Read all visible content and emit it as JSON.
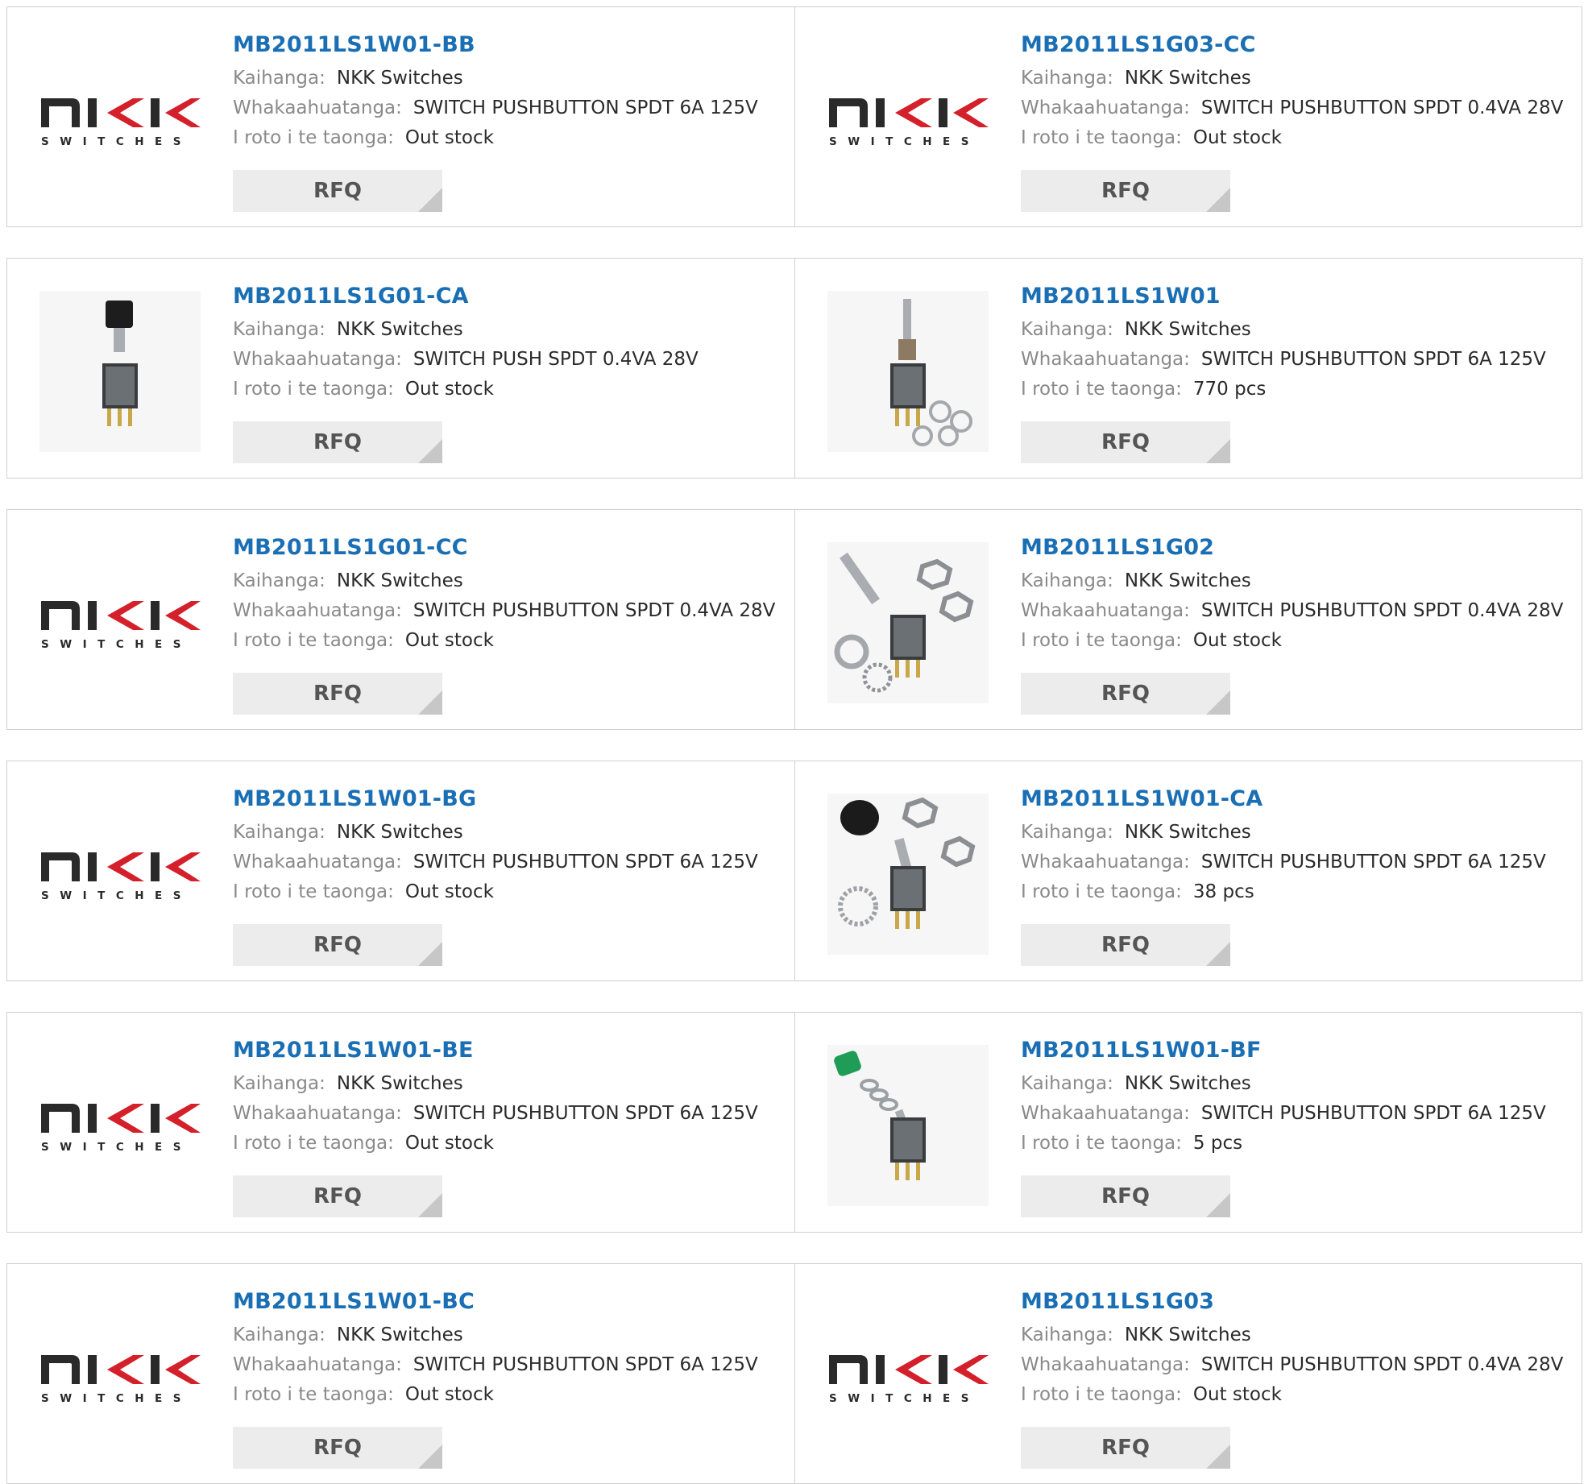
{
  "labels": {
    "manufacturer": "Kaihanga:",
    "description": "Whakaahuatanga:",
    "stock": "I roto i te taonga:",
    "rfq": "RFQ"
  },
  "logo_text": "SWITCHES",
  "colors": {
    "title": "#1a6fb4",
    "logo_red": "#d4202a",
    "logo_dark": "#2a2a2a"
  },
  "products": [
    {
      "part": "MB2011LS1W01-BB",
      "manufacturer": "NKK Switches",
      "description": "SWITCH PUSHBUTTON SPDT 6A 125V",
      "stock": "Out stock",
      "image": "nkk-logo"
    },
    {
      "part": "MB2011LS1G03-CC",
      "manufacturer": "NKK Switches",
      "description": "SWITCH PUSHBUTTON SPDT 0.4VA 28V",
      "stock": "Out stock",
      "image": "nkk-logo"
    },
    {
      "part": "MB2011LS1G01-CA",
      "manufacturer": "NKK Switches",
      "description": "SWITCH PUSH SPDT 0.4VA 28V",
      "stock": "Out stock",
      "image": "switch-black-cap"
    },
    {
      "part": "MB2011LS1W01",
      "manufacturer": "NKK Switches",
      "description": "SWITCH PUSHBUTTON SPDT 6A 125V",
      "stock": "770 pcs",
      "image": "switch-with-washers"
    },
    {
      "part": "MB2011LS1G01-CC",
      "manufacturer": "NKK Switches",
      "description": "SWITCH PUSHBUTTON SPDT 0.4VA 28V",
      "stock": "Out stock",
      "image": "nkk-logo"
    },
    {
      "part": "MB2011LS1G02",
      "manufacturer": "NKK Switches",
      "description": "SWITCH PUSHBUTTON SPDT 0.4VA 28V",
      "stock": "Out stock",
      "image": "switch-with-nuts"
    },
    {
      "part": "MB2011LS1W01-BG",
      "manufacturer": "NKK Switches",
      "description": "SWITCH PUSHBUTTON SPDT 6A 125V",
      "stock": "Out stock",
      "image": "nkk-logo"
    },
    {
      "part": "MB2011LS1W01-CA",
      "manufacturer": "NKK Switches",
      "description": "SWITCH PUSHBUTTON SPDT 6A 125V",
      "stock": "38 pcs",
      "image": "switch-cap-nuts"
    },
    {
      "part": "MB2011LS1W01-BE",
      "manufacturer": "NKK Switches",
      "description": "SWITCH PUSHBUTTON SPDT 6A 125V",
      "stock": "Out stock",
      "image": "nkk-logo"
    },
    {
      "part": "MB2011LS1W01-BF",
      "manufacturer": "NKK Switches",
      "description": "SWITCH PUSHBUTTON SPDT 6A 125V",
      "stock": "5 pcs",
      "image": "switch-green-cap"
    },
    {
      "part": "MB2011LS1W01-BC",
      "manufacturer": "NKK Switches",
      "description": "SWITCH PUSHBUTTON SPDT 6A 125V",
      "stock": "Out stock",
      "image": "nkk-logo"
    },
    {
      "part": "MB2011LS1G03",
      "manufacturer": "NKK Switches",
      "description": "SWITCH PUSHBUTTON SPDT 0.4VA 28V",
      "stock": "Out stock",
      "image": "nkk-logo"
    }
  ]
}
